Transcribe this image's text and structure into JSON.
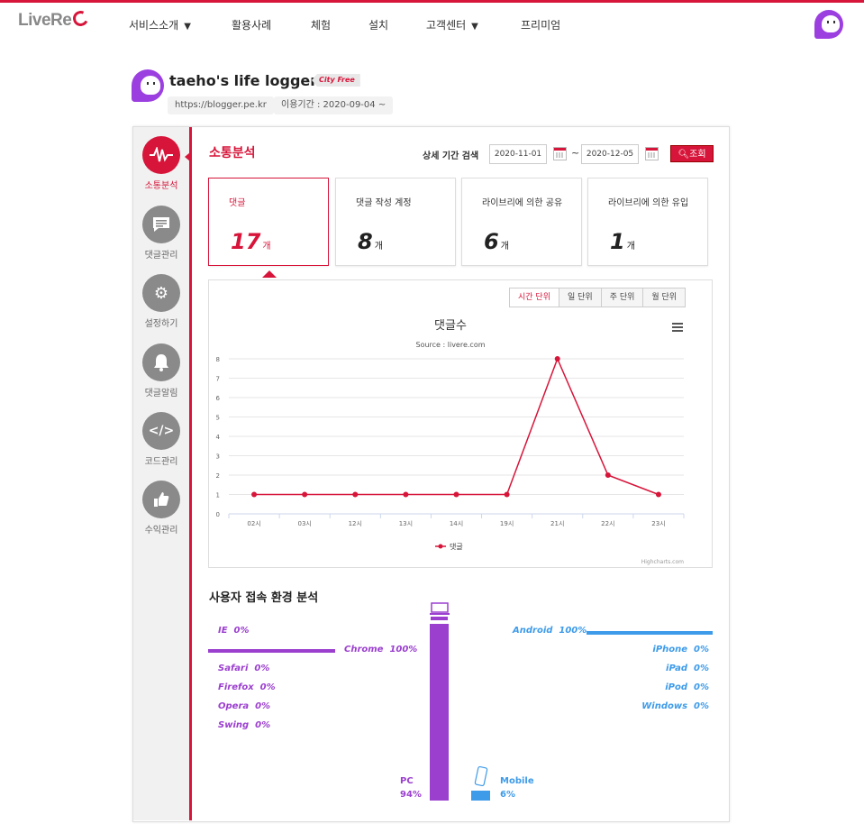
{
  "brand": {
    "logo_text": "LiveRe",
    "accent": "#d7153a",
    "purple": "#9b3fcf",
    "blue": "#3d9be9"
  },
  "nav": {
    "items": [
      "서비스소개",
      "활용사례",
      "체험",
      "설치",
      "고객센터",
      "프리미엄"
    ]
  },
  "site": {
    "title": "taeho's life logger",
    "badge": "City Free",
    "url": "https://blogger.pe.kr",
    "period": "이용기간 : 2020-09-04 ~"
  },
  "sidebar": {
    "items": [
      {
        "label": "소통분석",
        "icon": "pulse-icon"
      },
      {
        "label": "댓글관리",
        "icon": "comment-icon"
      },
      {
        "label": "설정하기",
        "icon": "gear-icon"
      },
      {
        "label": "댓글알림",
        "icon": "bell-icon"
      },
      {
        "label": "코드관리",
        "icon": "code-icon"
      },
      {
        "label": "수익관리",
        "icon": "thumbs-up-icon"
      }
    ]
  },
  "main": {
    "title": "소통분석",
    "date_label": "상세 기간 검색",
    "date_from": "2020-11-01",
    "date_to": "2020-12-05",
    "tilde": "~",
    "search_label": "조회"
  },
  "stats": [
    {
      "label": "댓글",
      "value": "17",
      "unit": "개"
    },
    {
      "label": "댓글 작성 계정",
      "value": "8",
      "unit": "개"
    },
    {
      "label": "라이브리에 의한 공유",
      "value": "6",
      "unit": "개"
    },
    {
      "label": "라이브리에 의한 유입",
      "value": "1",
      "unit": "개"
    }
  ],
  "unit_tabs": [
    "시간 단위",
    "일 단위",
    "주 단위",
    "월 단위"
  ],
  "chart_data": {
    "type": "line",
    "title": "댓글수",
    "subtitle": "Source : livere.com",
    "categories": [
      "02시",
      "03시",
      "12시",
      "13시",
      "14시",
      "19시",
      "21시",
      "22시",
      "23시"
    ],
    "series": [
      {
        "name": "댓글",
        "values": [
          1,
          1,
          1,
          1,
          1,
          1,
          8,
          2,
          1
        ],
        "color": "#d7153a"
      }
    ],
    "ylim": [
      0,
      8
    ],
    "yticks": [
      0,
      1,
      2,
      3,
      4,
      5,
      6,
      7,
      8
    ],
    "grid": true,
    "legend": "bottom-center",
    "credit": "Highcharts.com"
  },
  "env": {
    "title": "사용자 접속 환경 분석",
    "browsers": [
      {
        "name": "IE",
        "pct": "0%"
      },
      {
        "name": "Chrome",
        "pct": "100%"
      },
      {
        "name": "Safari",
        "pct": "0%"
      },
      {
        "name": "Firefox",
        "pct": "0%"
      },
      {
        "name": "Opera",
        "pct": "0%"
      },
      {
        "name": "Swing",
        "pct": "0%"
      }
    ],
    "mobile_os": [
      {
        "name": "Android",
        "pct": "100%"
      },
      {
        "name": "iPhone",
        "pct": "0%"
      },
      {
        "name": "iPad",
        "pct": "0%"
      },
      {
        "name": "iPod",
        "pct": "0%"
      },
      {
        "name": "Windows",
        "pct": "0%"
      }
    ],
    "pc": {
      "label": "PC",
      "pct": "94%",
      "share": 0.94
    },
    "mobile": {
      "label": "Mobile",
      "pct": "6%",
      "share": 0.06
    }
  }
}
